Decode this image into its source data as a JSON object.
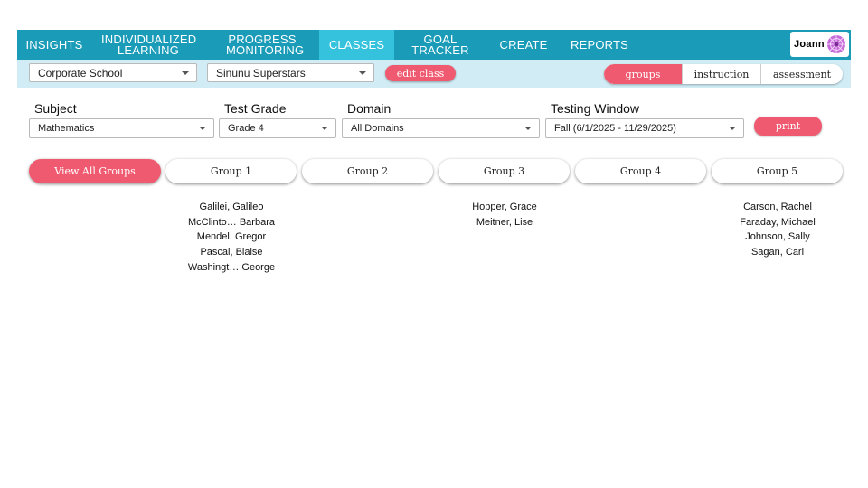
{
  "nav": {
    "items": [
      {
        "label": "INSIGHTS"
      },
      {
        "label": "INDIVIDUALIZED LEARNING"
      },
      {
        "label": "PROGRESS MONITORING"
      },
      {
        "label": "CLASSES"
      },
      {
        "label": "GOAL TRACKER"
      },
      {
        "label": "CREATE"
      },
      {
        "label": "REPORTS"
      }
    ],
    "active": "CLASSES",
    "user": "Joann"
  },
  "subbar": {
    "school": "Corporate School",
    "class": "Sinunu Superstars",
    "edit_label": "edit class",
    "views": [
      "groups",
      "instruction",
      "assessment"
    ],
    "active_view": "groups"
  },
  "filters": {
    "subject_label": "Subject",
    "subject_value": "Mathematics",
    "grade_label": "Test Grade",
    "grade_value": "Grade 4",
    "domain_label": "Domain",
    "domain_value": "All Domains",
    "window_label": "Testing Window",
    "window_value": "Fall (6/1/2025 - 11/29/2025)",
    "print_label": "print"
  },
  "groups": {
    "tabs": [
      "View All Groups",
      "Group 1",
      "Group 2",
      "Group 3",
      "Group 4",
      "Group 5"
    ],
    "active": "View All Groups",
    "members": {
      "group1": [
        "Galilei, Galileo",
        "McClinto…  Barbara",
        "Mendel, Gregor",
        "Pascal, Blaise",
        "Washingt…  George"
      ],
      "group3": [
        "Hopper, Grace",
        "Meitner, Lise"
      ],
      "group5": [
        "Carson, Rachel",
        "Faraday, Michael",
        "Johnson, Sally",
        "Sagan, Carl"
      ]
    }
  },
  "colors": {
    "nav_bg": "#1a9bb8",
    "nav_active": "#35c2dc",
    "subbar_bg": "#d1ecf4",
    "accent": "#ef5a70"
  }
}
